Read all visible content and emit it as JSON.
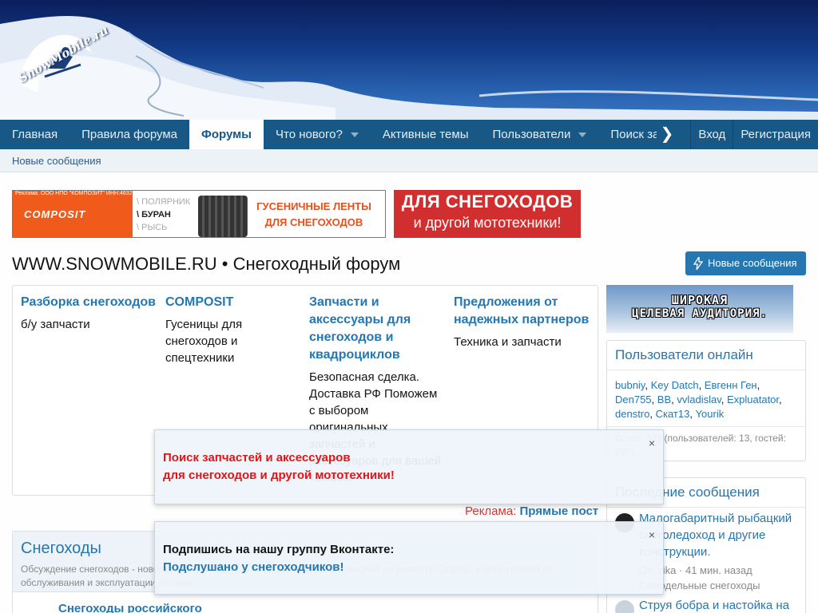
{
  "site": {
    "logo_text": "SnowMobile.ru"
  },
  "nav": {
    "items": [
      {
        "label": "Главная",
        "active": false,
        "caret": false
      },
      {
        "label": "Правила форума",
        "active": false,
        "caret": false
      },
      {
        "label": "Форумы",
        "active": true,
        "caret": false
      },
      {
        "label": "Что нового?",
        "active": false,
        "caret": true
      },
      {
        "label": "Активные темы",
        "active": false,
        "caret": false
      },
      {
        "label": "Пользователи",
        "active": false,
        "caret": true
      },
      {
        "label": "Поиск за",
        "active": false,
        "caret": false
      }
    ],
    "scroll_glyph": "❯",
    "login": "Вход",
    "register": "Регистрация"
  },
  "subnav": {
    "new_posts": "Новые сообщения"
  },
  "ads": {
    "composit": {
      "legal": "Реклама. ООО НПО \"КОМПОЗИТ\" ИНН:4632169626. ERID:2VfnxwwvhD2",
      "brand": "COMPOSIT",
      "models": [
        "\\ ПОЛЯРНИК",
        "\\ БУРАН",
        "\\ РЫСЬ"
      ],
      "title_l1": "ГУСЕНИЧНЫЕ ЛЕНТЫ",
      "title_l2": "ДЛЯ СНЕГОХОДОВ"
    },
    "red": {
      "line1": "ДЛЯ СНЕГОХОДОВ",
      "line2": "и другой мототехники!"
    }
  },
  "page": {
    "title": "WWW.SNOWMOBILE.RU • Снегоходный форум",
    "new_posts_button": "Новые сообщения"
  },
  "partners": [
    {
      "title": "Разборка снегоходов",
      "desc": "б/у запчасти"
    },
    {
      "title": "COMPOSIT",
      "desc": "Гусеницы для снегоходов и спецтехники"
    },
    {
      "title": "Запчасти и аксессуары для снегоходов и квадроциклов",
      "desc": "Безопасная сделка. Доставка РФ Поможем с выбором оригинальных запчастей и аксессуаров для вашей техники"
    },
    {
      "title": "Предложения от надежных партнеров",
      "desc": "Техника и запчасти"
    }
  ],
  "ad_line": {
    "label": "Реклама:",
    "link": "Прямые пост"
  },
  "category": {
    "title": "Снегоходы",
    "desc": "Обсуждение снегоходов - нового и б/у. Запчасти, тюнинг, делимся информацией по ремонту. Отзывы и впечатления от обслуживания и эксплуатации техники.",
    "first_node": "Снегоходы российского"
  },
  "sidebar": {
    "banner_l1": "ШИРОКАЯ",
    "banner_l2": "ЦЕЛЕВАЯ АУДИТОРИЯ.",
    "online": {
      "title": "Пользователи онлайн",
      "users": [
        "bubniy",
        "Key Datch",
        "Евгенн Ген",
        "Den755",
        "BB",
        "vvladislav",
        "Expluatator",
        "denstro",
        "Скат13",
        "Yourik"
      ],
      "stats": "Всего: 303 (пользователей: 13, гостей: 290)"
    },
    "latest": {
      "title": "Последние сообщения",
      "posts": [
        {
          "title": "Малогабаритный рыбацкий снеголедоход и другие конструкции.",
          "meta": "От: zika · 41 мин. назад",
          "forum": "Самодельные снегоходы"
        },
        {
          "title": "Струя бобра и настойка на",
          "meta": "",
          "forum": ""
        }
      ]
    }
  },
  "notices": [
    {
      "line1": "Поиск запчастей и аксессуаров",
      "line2": "для снегоходов и другой мототехники!",
      "color": "#e01515"
    },
    {
      "line1": "Подпишись на нашу группу Вконтакте:",
      "line2": "Подслушано у снегоходчиков!"
    }
  ],
  "icons": {
    "close": "×"
  },
  "colors": {
    "nav_bg": "#185886",
    "link": "#2577b1",
    "accent_red": "#d12f2f",
    "composit_orange": "#f05a1a"
  }
}
